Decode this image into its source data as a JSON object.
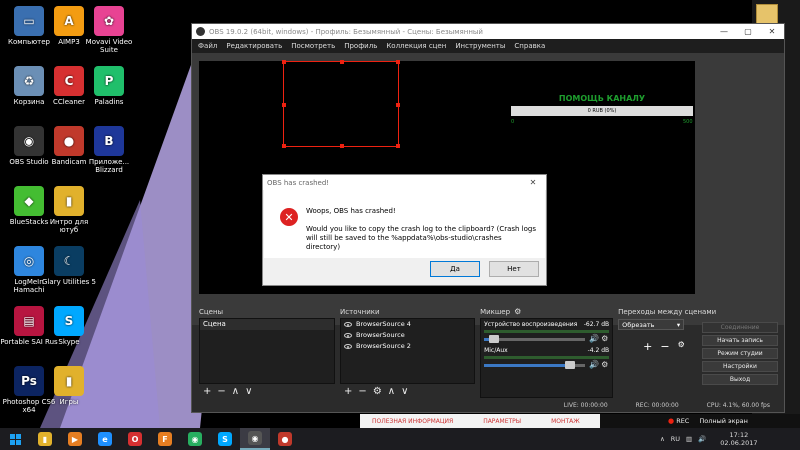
{
  "desktop": {
    "icons": [
      {
        "name": "desktop-icon-computer",
        "label": "Компьютер",
        "glyph": "▭",
        "color": "#3a6fb0"
      },
      {
        "name": "desktop-icon-aimp",
        "label": "AIMP3",
        "glyph": "A",
        "color": "#f39c12"
      },
      {
        "name": "desktop-icon-movavi",
        "label": "Movavi Video Suite",
        "glyph": "✿",
        "color": "#e84393"
      },
      {
        "name": "desktop-icon-recycle-bin",
        "label": "Корзина",
        "glyph": "♻",
        "color": "#6b8fb5"
      },
      {
        "name": "desktop-icon-ccleaner",
        "label": "CCleaner",
        "glyph": "C",
        "color": "#d63031"
      },
      {
        "name": "desktop-icon-paladins",
        "label": "Paladins",
        "glyph": "P",
        "color": "#20bf6b"
      },
      {
        "name": "desktop-icon-obs",
        "label": "OBS Studio",
        "glyph": "◉",
        "color": "#333"
      },
      {
        "name": "desktop-icon-bandicam",
        "label": "Bandicam",
        "glyph": "●",
        "color": "#c0392b"
      },
      {
        "name": "desktop-icon-blizzard",
        "label": "Приложе... Blizzard",
        "glyph": "B",
        "color": "#1e3799"
      },
      {
        "name": "desktop-icon-bluestacks",
        "label": "BlueStacks",
        "glyph": "◆",
        "color": "#44bd32"
      },
      {
        "name": "desktop-icon-folder-youtube",
        "label": "Интро для ютуб",
        "glyph": "▮",
        "color": "#e1b12c"
      },
      {
        "name": "desktop-icon-logmein",
        "label": "LogMeIn Hamachi",
        "glyph": "◎",
        "color": "#2e86de"
      },
      {
        "name": "desktop-icon-glary",
        "label": "Glary Utilities 5",
        "glyph": "☾",
        "color": "#0a3d62"
      },
      {
        "name": "desktop-icon-sai",
        "label": "Portable SAI Rus",
        "glyph": "▤",
        "color": "#b71540"
      },
      {
        "name": "desktop-icon-skype",
        "label": "Skype",
        "glyph": "S",
        "color": "#00a8ff"
      },
      {
        "name": "desktop-icon-photoshop",
        "label": "Photoshop CS6 x64",
        "glyph": "Ps",
        "color": "#0c2461"
      },
      {
        "name": "desktop-icon-folder-games",
        "label": "Игры",
        "glyph": "▮",
        "color": "#e1b12c"
      }
    ]
  },
  "obs": {
    "title": "OBS 19.0.2 (64bit, windows) - Профиль: Безымянный - Сцены: Безымянный",
    "win_min": "—",
    "win_max": "▢",
    "win_close": "✕",
    "menu": [
      "Файл",
      "Редактировать",
      "Посмотреть",
      "Профиль",
      "Коллекция сцен",
      "Инструменты",
      "Справка"
    ],
    "donate": {
      "title": "ПОМОЩЬ КАНАЛУ",
      "bar_label": "0 RUB (0%)",
      "min": "0",
      "max": "500"
    },
    "docks": {
      "scenes_title": "Сцены",
      "scenes": [
        "Сцена"
      ],
      "sources_title": "Источники",
      "sources": [
        "BrowserSource 4",
        "BrowserSource",
        "BrowserSource 2"
      ],
      "mixer_title": "Микшер",
      "mixer": [
        {
          "name": "Устройство воспроизведения",
          "db": "-62.7 dB",
          "level": 0.1
        },
        {
          "name": "Mic/Aux",
          "db": "-4.2 dB",
          "level": 0.85
        }
      ],
      "transitions_title": "Переходы между сценами",
      "transition_selected": "Обрезать"
    },
    "controls": {
      "studio_btn": "Соединение",
      "start_rec": "Начать запись",
      "studio_mode": "Режим студии",
      "settings": "Настройки",
      "exit": "Выход"
    },
    "status": {
      "live": "LIVE: 00:00:00",
      "rec": "REC: 00:00:00",
      "cpu": "CPU: 4.1%, 60.00 fps"
    }
  },
  "crash": {
    "title": "OBS has crashed!",
    "close": "✕",
    "message1": "Woops, OBS has crashed!",
    "message2": "Would you like to copy the crash log to the clipboard?  (Crash logs will still be saved to the %appdata%\\obs-studio\\crashes directory)",
    "yes": "Да",
    "no": "Нет"
  },
  "browser_strip": [
    "ПОЛЕЗНАЯ ИНФОРМАЦИЯ",
    "ПАРАМЕТРЫ",
    "МОНТАЖ"
  ],
  "fullscreen_bar": {
    "rec": "REC",
    "label": "Полный экран"
  },
  "taskbar": {
    "items": [
      {
        "name": "taskbar-explorer",
        "glyph": "▮",
        "color": "#e1b12c"
      },
      {
        "name": "taskbar-media",
        "glyph": "▶",
        "color": "#e67e22"
      },
      {
        "name": "taskbar-ie",
        "glyph": "e",
        "color": "#1e90ff"
      },
      {
        "name": "taskbar-opera",
        "glyph": "O",
        "color": "#d63031"
      },
      {
        "name": "taskbar-firefox",
        "glyph": "F",
        "color": "#e67e22"
      },
      {
        "name": "taskbar-chrome",
        "glyph": "◉",
        "color": "#27ae60"
      },
      {
        "name": "taskbar-skype",
        "glyph": "S",
        "color": "#00a8ff"
      },
      {
        "name": "taskbar-obs",
        "glyph": "◉",
        "color": "#555"
      },
      {
        "name": "taskbar-bandicam",
        "glyph": "●",
        "color": "#c0392b"
      }
    ],
    "lang": "RU",
    "time": "17:12",
    "date": "02.06.2017"
  }
}
